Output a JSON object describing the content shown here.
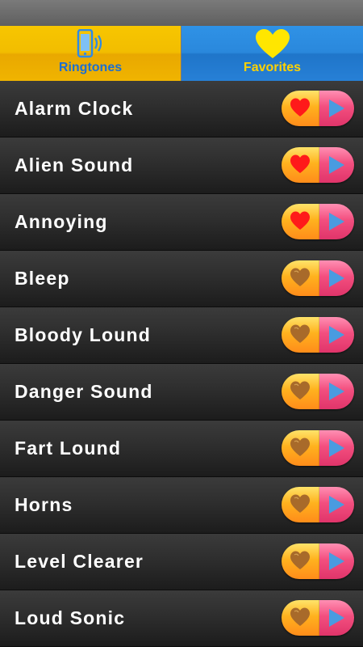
{
  "tabs": [
    {
      "label": "Ringtones",
      "icon": "phone-ringing-icon",
      "color": "#f2bd00",
      "active": true
    },
    {
      "label": "Favorites",
      "icon": "heart-icon",
      "color": "#2a88dc",
      "active": false
    }
  ],
  "colors": {
    "heart_favorited": "#ff1a1a",
    "heart_not_favorited": "#a86a2a",
    "play": "#4a9be0"
  },
  "ringtones": [
    {
      "name": "Alarm Clock",
      "favorited": true
    },
    {
      "name": "Alien Sound",
      "favorited": true
    },
    {
      "name": "Annoying",
      "favorited": true
    },
    {
      "name": "Bleep",
      "favorited": false
    },
    {
      "name": "Bloody Lound",
      "favorited": false
    },
    {
      "name": "Danger Sound",
      "favorited": false
    },
    {
      "name": "Fart Lound",
      "favorited": false
    },
    {
      "name": "Horns",
      "favorited": false
    },
    {
      "name": "Level Clearer",
      "favorited": false
    },
    {
      "name": "Loud Sonic",
      "favorited": false
    }
  ]
}
